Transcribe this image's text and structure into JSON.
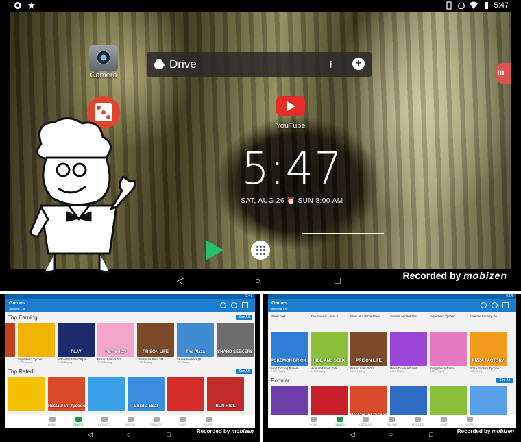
{
  "home": {
    "status_time": "5:47",
    "camera_label": "Camera",
    "drive_label": "Drive",
    "youtube_label": "YouTube",
    "clock_time": "5:47",
    "date_text": "SAT, AUG 26",
    "alarm_text": "SUN 8:00 AM",
    "recorded_by": "Recorded by",
    "recorder_brand": "mobizen",
    "edge_badge": "m"
  },
  "roblox": {
    "title": "Games",
    "subtitle": "welcome ChF",
    "recorded_by": "Recorded by",
    "recorder_brand": "mobizen",
    "see_all": "See All",
    "tabs": [
      "HOME",
      "GAMES",
      "CATALOG",
      "AVATAR",
      "FRIENDS",
      "CHAT",
      "MORE"
    ],
    "left": {
      "status_time": "5:47",
      "section1": "Top Earning",
      "section2": "Top Rated",
      "cards": [
        {
          "name": "The Floor Is Lava! 2...",
          "players": "3,229 Playing",
          "caption": "",
          "color": "#c2411f"
        },
        {
          "name": "Superhero Tycoon",
          "players": "2,235 Playing",
          "caption": "",
          "color": "#f0b400"
        },
        {
          "name": "[NEW PET SHOP] B...",
          "players": "5,369 Playing",
          "caption": "PLAY",
          "color": "#1d2a6b"
        },
        {
          "name": "Prison Life v2.0.2",
          "players": "3,229 Playing",
          "caption": "PET SHOP",
          "color": "#f3a6c9"
        },
        {
          "name": "The Plaza Beta 3M...",
          "players": "2,235 Playing",
          "caption": "PRISON LIFE",
          "color": "#7a4a2a"
        },
        {
          "name": "Shard Seekers (P...",
          "players": "367 Playing",
          "caption": "The Plaza",
          "color": "#3f8bd1"
        },
        {
          "name": "",
          "players": "",
          "caption": "SHARD SEEKERS",
          "color": "#6d6d6d"
        }
      ],
      "cards2": [
        {
          "caption": "",
          "color": "#f5c200"
        },
        {
          "caption": "Restaurant Tycoon",
          "color": "#d94a2a"
        },
        {
          "caption": "",
          "color": "#3aa0e8"
        },
        {
          "caption": "Build a Boat",
          "color": "#3a8fe0"
        },
        {
          "caption": "",
          "color": "#d42b2b"
        },
        {
          "caption": "RUN  HIDE",
          "color": "#c22a2a"
        }
      ]
    },
    "right": {
      "status_time": "6:14",
      "top_names": [
        "Water park",
        "The Floor Is Lava! 2...",
        "Work at a Pizza Place",
        "Survive and Kill the...",
        "Superhero Tycoon",
        "Free the Factory Se..."
      ],
      "section2": "Popular",
      "cards": [
        {
          "name": "[Hot! Doctor] Pokem...",
          "players": "3,835 Playing",
          "caption": "POKEMON BRICK BRONZE",
          "color": "#2f7fd6"
        },
        {
          "name": "Hide and Seek Extr...",
          "players": "2,229 Playing",
          "caption": "HIDE AND SEEK",
          "color": "#8bbf3a"
        },
        {
          "name": "Prison Life v2.0.2",
          "players": "3,229 Playing",
          "caption": "PRISON LIFE",
          "color": "#7a4a2a"
        },
        {
          "name": "Drive Down a Rainb...",
          "players": "2,229 Playing",
          "caption": "",
          "color": "#9c46d8"
        },
        {
          "name": "Imagination Fashi...",
          "players": "2,221 Playing",
          "caption": "",
          "color": "#e47ac2"
        },
        {
          "name": "Pizza Factory Tycoon",
          "players": "878 Playing",
          "caption": "PIZZA FACTORY",
          "color": "#f29a1c"
        }
      ],
      "cards2": [
        {
          "caption": "",
          "color": "#6e3fa8"
        },
        {
          "caption": "",
          "color": "#c8202a"
        },
        {
          "caption": "Restaurant Tycoon",
          "color": "#d94a2a"
        },
        {
          "caption": "",
          "color": "#2f6dc4"
        },
        {
          "caption": "",
          "color": "#8bbf3a"
        },
        {
          "caption": "",
          "color": "#5aa0e8"
        }
      ]
    }
  }
}
